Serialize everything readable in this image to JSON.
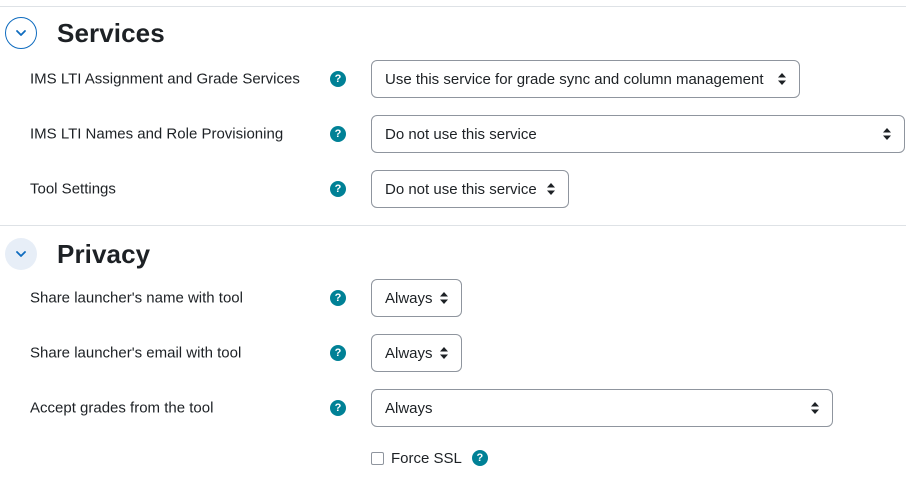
{
  "sections": {
    "services": {
      "title": "Services",
      "rows": [
        {
          "label": "IMS LTI Assignment and Grade Services",
          "value": "Use this service for grade sync and column management"
        },
        {
          "label": "IMS LTI Names and Role Provisioning",
          "value": "Do not use this service"
        },
        {
          "label": "Tool Settings",
          "value": "Do not use this service"
        }
      ]
    },
    "privacy": {
      "title": "Privacy",
      "rows": [
        {
          "label": "Share launcher's name with tool",
          "value": "Always"
        },
        {
          "label": "Share launcher's email with tool",
          "value": "Always"
        },
        {
          "label": "Accept grades from the tool",
          "value": "Always"
        }
      ],
      "force_ssl": {
        "label": "Force SSL",
        "checked": false
      }
    }
  },
  "icons": {
    "help": "?",
    "toggle": "chevron-down-icon",
    "caret": "sort-caret-icon"
  },
  "colors": {
    "help_icon": "#008196",
    "accent": "#0f6cbf",
    "text": "#1d2125",
    "border": "#8f959e"
  }
}
